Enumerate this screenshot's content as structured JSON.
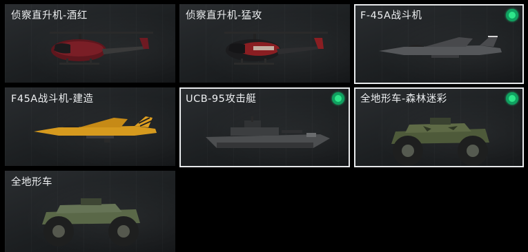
{
  "cards": [
    {
      "label": "侦察直升机-酒红",
      "icon": "helicopter-icon",
      "equipped": false,
      "selected": false,
      "accent": "#6e1a22"
    },
    {
      "label": "侦察直升机-猛攻",
      "icon": "helicopter-icon",
      "equipped": false,
      "selected": false,
      "accent": "#8a1e22"
    },
    {
      "label": "F-45A战斗机",
      "icon": "fighter-jet-icon",
      "equipped": true,
      "selected": true,
      "accent": "#5c5e60"
    },
    {
      "label": "F45A战斗机-建造",
      "icon": "fighter-jet-icon",
      "equipped": false,
      "selected": false,
      "accent": "#e0a020"
    },
    {
      "label": "UCB-95攻击艇",
      "icon": "boat-icon",
      "equipped": true,
      "selected": true,
      "accent": "#505254"
    },
    {
      "label": "全地形车-森林迷彩",
      "icon": "atv-icon",
      "equipped": true,
      "selected": true,
      "accent": "#4e5a3a"
    },
    {
      "label": "全地形车",
      "icon": "atv-icon",
      "equipped": false,
      "selected": false,
      "accent": "#5a6848"
    }
  ],
  "colors": {
    "equipped_badge": "#2ee68a",
    "selected_border": "#e8eaec",
    "background": "#000000"
  }
}
